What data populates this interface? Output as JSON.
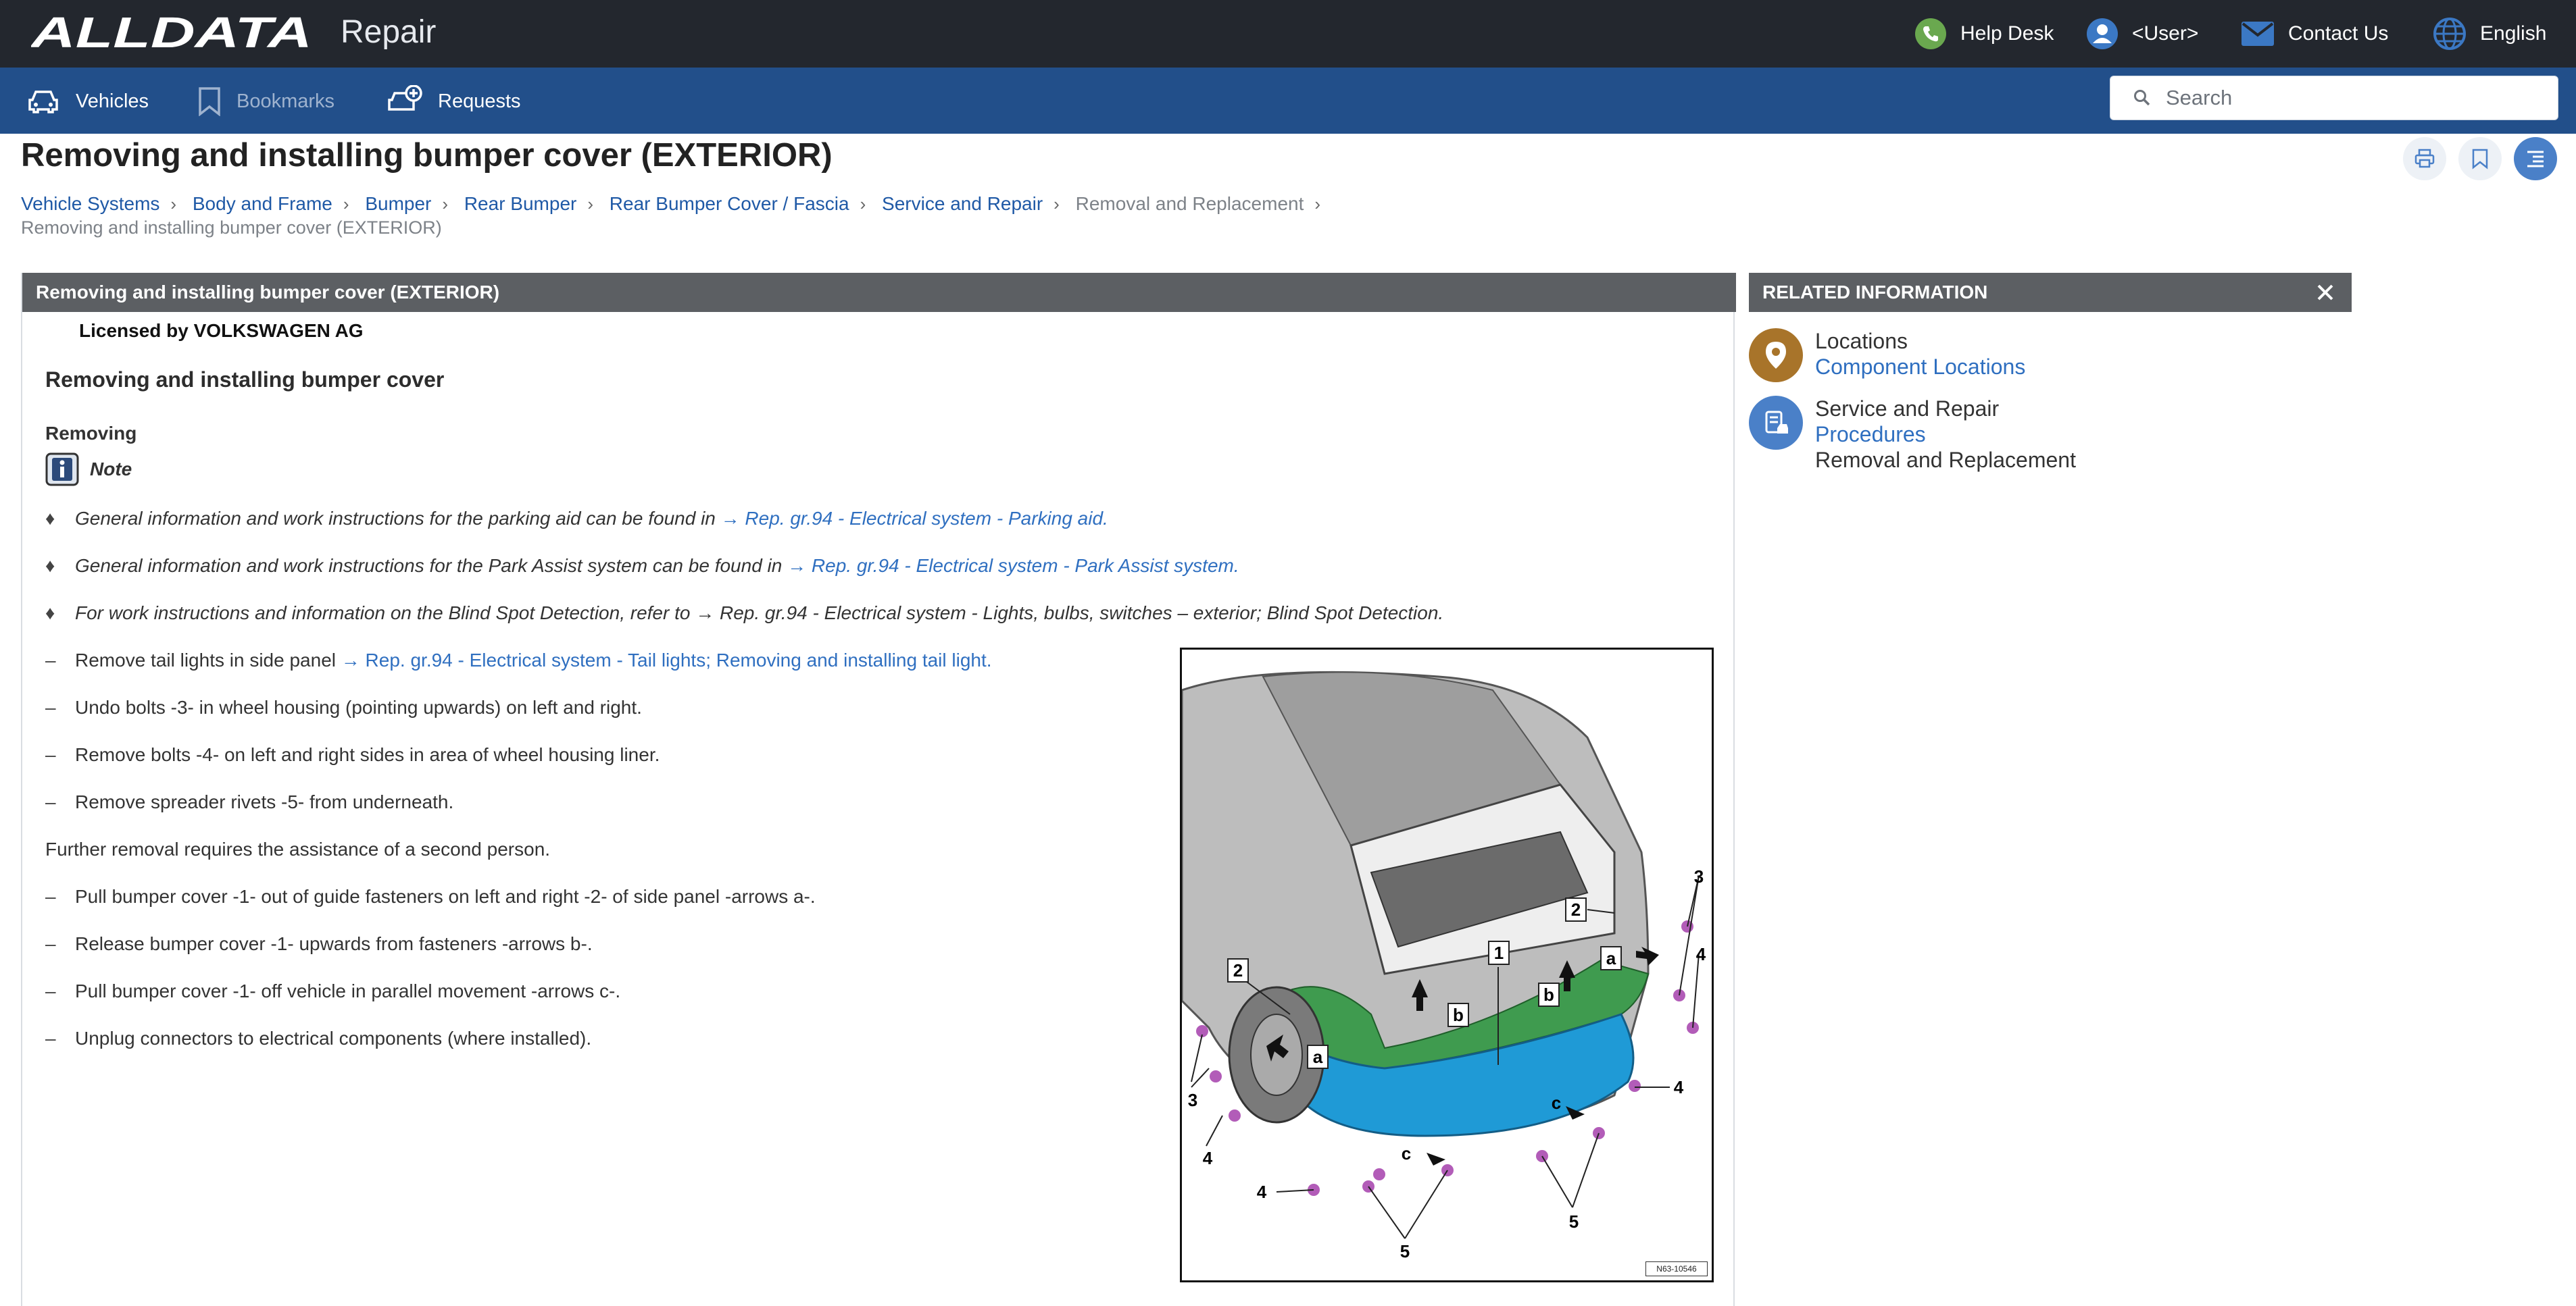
{
  "app": {
    "brand": "ALLDATA",
    "name": "Repair"
  },
  "topbar": {
    "help_desk": "Help Desk",
    "user": "<User>",
    "contact": "Contact Us",
    "language": "English"
  },
  "nav": {
    "vehicles": "Vehicles",
    "bookmarks": "Bookmarks",
    "requests": "Requests"
  },
  "search": {
    "placeholder": "Search"
  },
  "page": {
    "title": "Removing and installing bumper cover (EXTERIOR)",
    "breadcrumb": [
      "Vehicle Systems",
      "Body and Frame",
      "Bumper",
      "Rear Bumper",
      "Rear Bumper Cover / Fascia",
      "Service and Repair",
      "Removal and Replacement"
    ],
    "breadcrumb_last": "Removing and installing bumper cover (EXTERIOR)"
  },
  "doc": {
    "header": "Removing and installing bumper cover (EXTERIOR)",
    "licensed": "Licensed by VOLKSWAGEN AG",
    "heading": "Removing and installing bumper cover",
    "subheading": "Removing",
    "note_label": "Note",
    "notes": [
      {
        "text": "General information and work instructions for the parking aid can be found in ",
        "link": "→ Rep. gr.94 - Electrical system - Parking aid."
      },
      {
        "text": "General information and work instructions for the Park Assist system can be found in ",
        "link": "→ Rep. gr.94 - Electrical system - Park Assist system."
      },
      {
        "text": "For work instructions and information on the Blind Spot Detection, refer to → Rep. gr.94 - Electrical system - Lights, bulbs, switches – exterior; Blind Spot Detection.",
        "link": ""
      }
    ],
    "step_tail": {
      "text": "Remove tail lights in side panel ",
      "link": "→ Rep. gr.94 - Electrical system - Tail lights; Removing and installing tail light."
    },
    "steps_a": [
      "Undo bolts -3- in wheel housing (pointing upwards) on left and right.",
      "Remove bolts -4- on left and right sides in area of wheel housing liner.",
      "Remove spreader rivets -5- from underneath."
    ],
    "further": "Further removal requires the assistance of a second person.",
    "steps_b": [
      "Pull bumper cover -1- out of guide fasteners on left and right -2- of side panel -arrows a-.",
      "Release bumper cover -1- upwards from fasteners -arrows b-.",
      "Pull bumper cover -1- off vehicle in parallel movement -arrows c-.",
      "Unplug connectors to electrical components (where installed)."
    ],
    "bullet_mark": "♦",
    "dash_mark": "–",
    "figure": {
      "tag": "N63-10546",
      "callouts": {
        "c1": "1",
        "c2": "2",
        "c3": "3",
        "c4": "4",
        "c5": "5",
        "ca": "a",
        "cb": "b",
        "cc": "c"
      }
    }
  },
  "related": {
    "header": "RELATED INFORMATION",
    "items": [
      {
        "title": "Locations",
        "link": "Component Locations",
        "extra": ""
      },
      {
        "title": "Service and Repair",
        "link": "Procedures",
        "extra": "Removal and Replacement"
      }
    ]
  },
  "colors": {
    "topbar": "#23272e",
    "navbar": "#224f8a",
    "link": "#2f6fc0",
    "panel_header": "#5c5f63",
    "bumper": "#1f9ad6",
    "fastener": "#b25cb8"
  },
  "icons": [
    "phone-icon",
    "user-icon",
    "mail-icon",
    "globe-icon",
    "car-icon",
    "bookmark-icon",
    "request-icon",
    "search-icon",
    "print-icon",
    "bookmark-add-icon",
    "toc-icon",
    "close-icon",
    "location-pin-icon",
    "service-icon",
    "info-note-icon"
  ]
}
